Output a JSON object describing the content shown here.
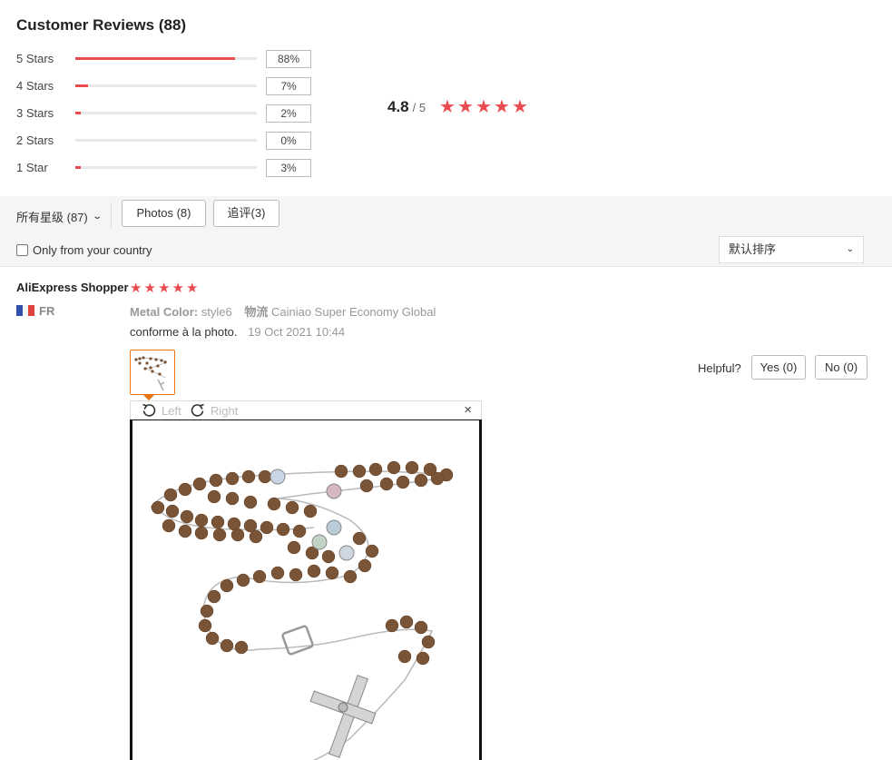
{
  "header": {
    "title": "Customer Reviews (88)"
  },
  "ratings": [
    {
      "label": "5 Stars",
      "percent_label": "88%",
      "fill": 0.88
    },
    {
      "label": "4 Stars",
      "percent_label": "7%",
      "fill": 0.07
    },
    {
      "label": "3 Stars",
      "percent_label": "2%",
      "fill": 0.02
    },
    {
      "label": "2 Stars",
      "percent_label": "0%",
      "fill": 0.0
    },
    {
      "label": "1 Star",
      "percent_label": "3%",
      "fill": 0.03
    }
  ],
  "average": {
    "value": "4.8",
    "out_of": "/ 5",
    "stars": 4.8
  },
  "filters": {
    "all_stars_label": "所有星级 (87)",
    "photos_label": "Photos (8)",
    "additional_label": "追评(3)",
    "country_label": "Only from your country",
    "country_checked": false,
    "sort_label": "默认排序"
  },
  "review": {
    "reviewer": "AliExpress Shopper",
    "stars": 5,
    "country_code": "FR",
    "attr_color_key": "Metal Color:",
    "attr_color_val": "style6",
    "attr_ship_key": "物流",
    "attr_ship_val": "Cainiao Super Economy Global",
    "comment": "conforme à la photo.",
    "date": "19 Oct 2021 10:44",
    "helpful_label": "Helpful?",
    "yes_label": "Yes (0)",
    "no_label": "No (0)"
  },
  "viewer": {
    "rotate_left_label": "Left",
    "rotate_right_label": "Right",
    "close_symbol": "×"
  },
  "colors": {
    "accent": "#e94b4f",
    "thumb_border": "#e87512"
  }
}
